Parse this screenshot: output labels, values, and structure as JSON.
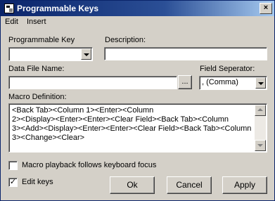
{
  "window": {
    "title": "Programmable Keys",
    "close_glyph": "×"
  },
  "menu": {
    "items": [
      {
        "label": "Edit"
      },
      {
        "label": "Insert"
      }
    ]
  },
  "form": {
    "programmable_key": {
      "label": "Programmable Key",
      "value": ""
    },
    "description": {
      "label": "Description:",
      "value": ""
    },
    "data_file_name": {
      "label": "Data File Name:",
      "value": "",
      "browse_label": "..."
    },
    "field_separator": {
      "label": "Field Seperator:",
      "value": ", (Comma)"
    },
    "macro_definition": {
      "label": "Macro Definition:",
      "lines": [
        "<Back Tab><Column 1><Enter><Column",
        "2><Display><Enter><Enter><Clear Field><Back Tab><Column",
        "3><Add><Display><Enter><Enter><Clear Field><Back Tab><Column",
        "3><Change><Clear>"
      ]
    },
    "macro_playback": {
      "label": "Macro playback follows keyboard focus",
      "checked": false
    },
    "edit_keys": {
      "label": "Edit keys",
      "checked": true,
      "check_glyph": "✓"
    }
  },
  "buttons": {
    "ok": "Ok",
    "cancel": "Cancel",
    "apply": "Apply"
  }
}
